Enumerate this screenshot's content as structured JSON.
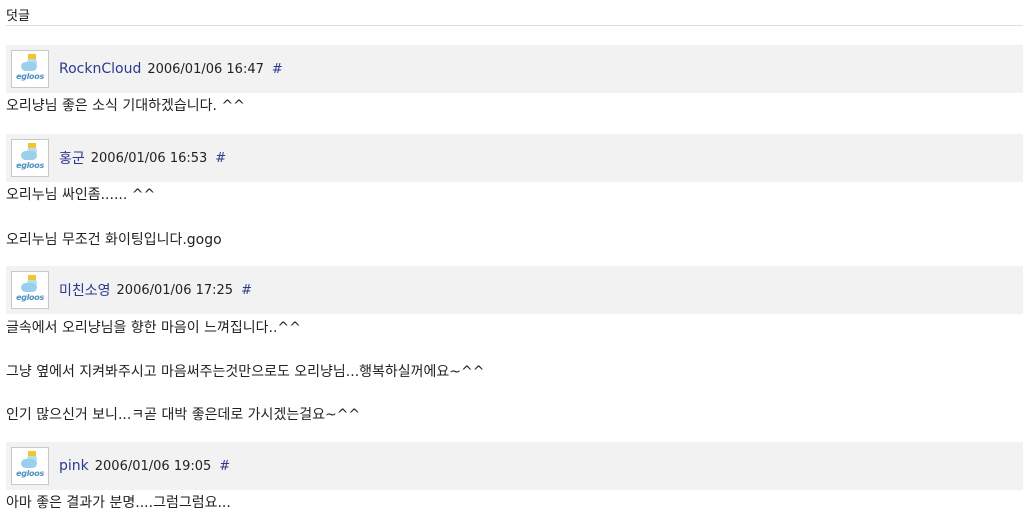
{
  "section": {
    "title": "덧글"
  },
  "avatar_logo_text": "egloos",
  "comments": [
    {
      "author": "RocknCloud",
      "datetime": "2006/01/06 16:47",
      "permalink": "#",
      "lines": [
        "오리냥님 좋은 소식 기대하겠습니다. ^^"
      ]
    },
    {
      "author": "홍군",
      "datetime": "2006/01/06 16:53",
      "permalink": "#",
      "lines": [
        "오리누님 싸인좀...... ^^",
        "오리누님 무조건 화이팅입니다.gogo"
      ]
    },
    {
      "author": "미친소영",
      "datetime": "2006/01/06 17:25",
      "permalink": "#",
      "lines": [
        "글속에서 오리냥님을 향한 마음이 느껴집니다..^^",
        "그냥 옆에서 지켜봐주시고 마음써주는것만으로도 오리냥님...행복하실꺼에요~^^",
        "인기 많으신거 보니...ㅋ곧 대박 좋은데로 가시겠는걸요~^^"
      ]
    },
    {
      "author": "pink",
      "datetime": "2006/01/06 19:05",
      "permalink": "#",
      "lines": [
        "아마 좋은 결과가 분명....그럼그럼요..."
      ]
    }
  ]
}
